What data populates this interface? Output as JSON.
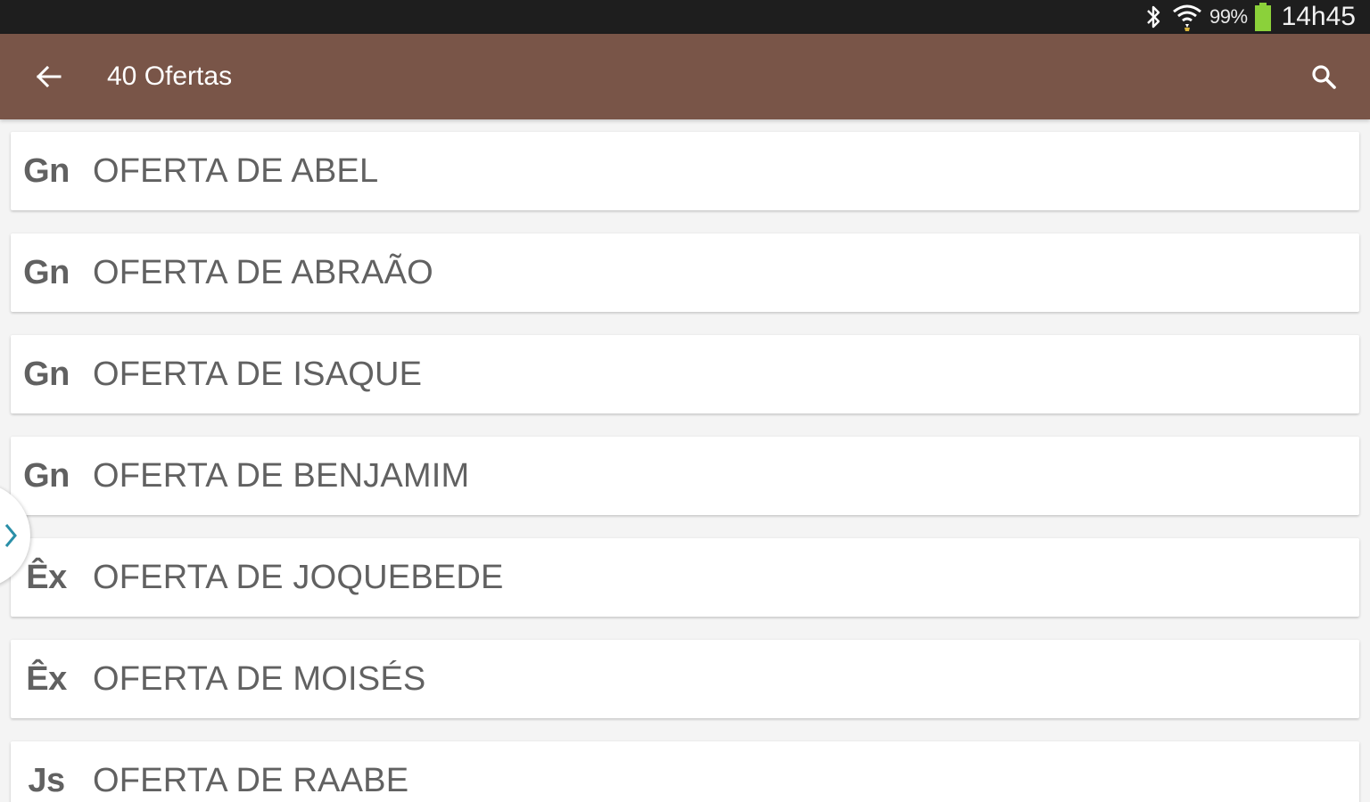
{
  "status_bar": {
    "battery_percent": "99%",
    "time": "14h45",
    "icons": [
      "bluetooth-icon",
      "wifi-icon",
      "battery-icon"
    ],
    "battery_color": "#8bd13a"
  },
  "toolbar": {
    "title": "40 Ofertas",
    "back_icon": "arrow-left-icon",
    "search_icon": "search-icon",
    "background": "#795548"
  },
  "offers": [
    {
      "book": "Gn",
      "title": "OFERTA DE ABEL"
    },
    {
      "book": "Gn",
      "title": "OFERTA DE ABRAÃO"
    },
    {
      "book": "Gn",
      "title": "OFERTA DE ISAQUE"
    },
    {
      "book": "Gn",
      "title": "OFERTA DE BENJAMIM"
    },
    {
      "book": "Êx",
      "title": "OFERTA DE JOQUEBEDE"
    },
    {
      "book": "Êx",
      "title": "OFERTA DE MOISÉS"
    },
    {
      "book": "Js",
      "title": "OFERTA DE RAABE"
    }
  ],
  "drawer_handle": {
    "icon": "chevron-right-icon",
    "accent": "#2a8fa8"
  }
}
